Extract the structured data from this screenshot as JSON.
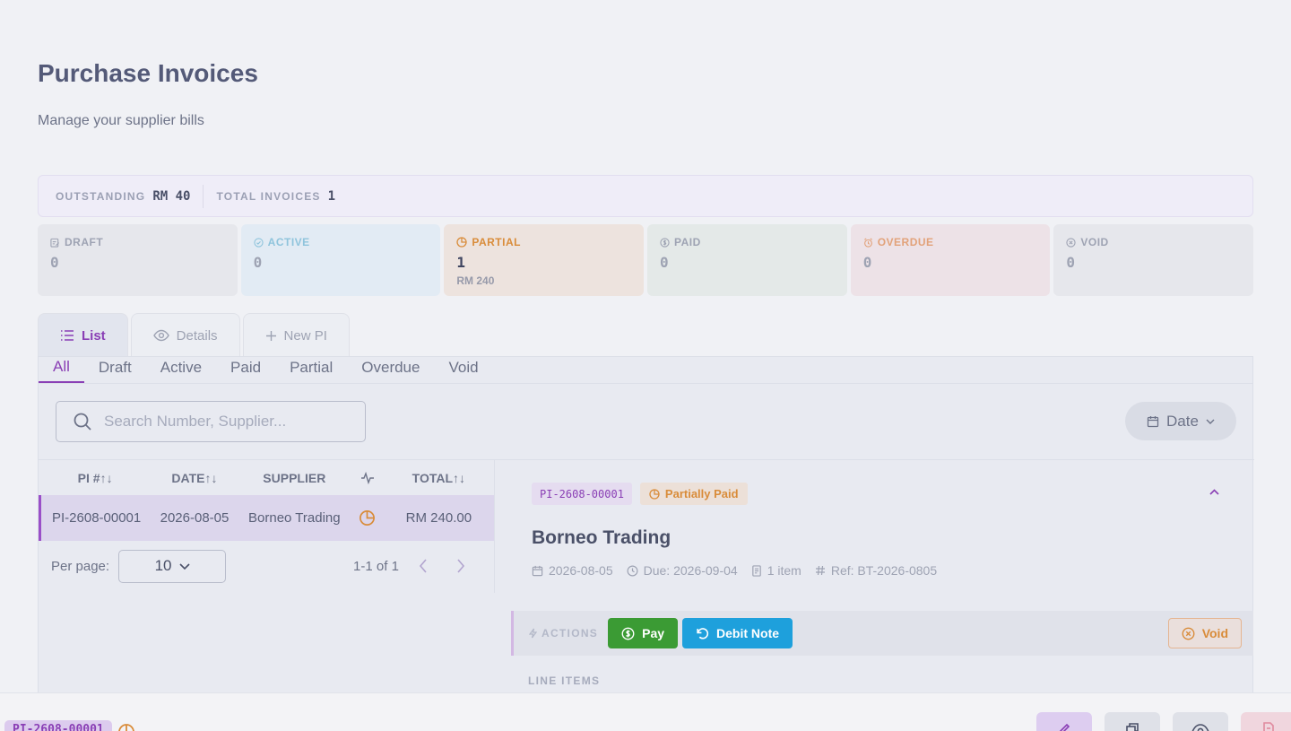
{
  "page": {
    "title": "Purchase Invoices",
    "subtitle": "Manage your supplier bills"
  },
  "summary": {
    "outstanding_label": "OUTSTANDING",
    "outstanding_value": "RM 40",
    "total_label": "TOTAL INVOICES",
    "total_value": "1"
  },
  "status_cards": [
    {
      "label": "DRAFT",
      "count": "0",
      "icon": "draft-icon"
    },
    {
      "label": "ACTIVE",
      "count": "0",
      "icon": "check-circle-icon"
    },
    {
      "label": "PARTIAL",
      "count": "1",
      "amount": "RM 240",
      "icon": "pie-chart-icon"
    },
    {
      "label": "PAID",
      "count": "0",
      "icon": "dollar-circle-icon"
    },
    {
      "label": "OVERDUE",
      "count": "0",
      "icon": "alarm-icon"
    },
    {
      "label": "VOID",
      "count": "0",
      "icon": "x-circle-icon"
    }
  ],
  "tabs": [
    {
      "label": "List",
      "icon": "list-icon",
      "active": true
    },
    {
      "label": "Details",
      "icon": "eye-icon"
    },
    {
      "label": "New PI",
      "icon": "plus-icon"
    }
  ],
  "filters": [
    "All",
    "Draft",
    "Active",
    "Paid",
    "Partial",
    "Overdue",
    "Void"
  ],
  "search": {
    "placeholder": "Search Number, Supplier..."
  },
  "sort_button": {
    "label": "Date"
  },
  "table": {
    "columns": [
      "PI #",
      "DATE",
      "SUPPLIER",
      "TOTAL"
    ],
    "rows": [
      {
        "pi": "PI-2608-00001",
        "date": "2026-08-05",
        "supplier": "Borneo Trading",
        "total": "RM 240.00"
      }
    ]
  },
  "pagination": {
    "per_page_label": "Per page:",
    "per_page_value": "10",
    "range": "1-1 of 1"
  },
  "detail": {
    "pi_number": "PI-2608-00001",
    "status": "Partially Paid",
    "supplier": "Borneo Trading",
    "date": "2026-08-05",
    "due": "Due: 2026-09-04",
    "items": "1 item",
    "ref": "Ref: BT-2026-0805"
  },
  "actions": {
    "label": "ACTIONS",
    "pay": "Pay",
    "debit_note": "Debit Note",
    "void": "Void"
  },
  "line_items_label": "LINE ITEMS",
  "footer": {
    "pi_number": "PI-2608-00001"
  },
  "colors": {
    "accent": "#8a3fb5",
    "partial": "#d98c3a",
    "pay": "#3b9b34",
    "debit": "#1ea0dc"
  }
}
